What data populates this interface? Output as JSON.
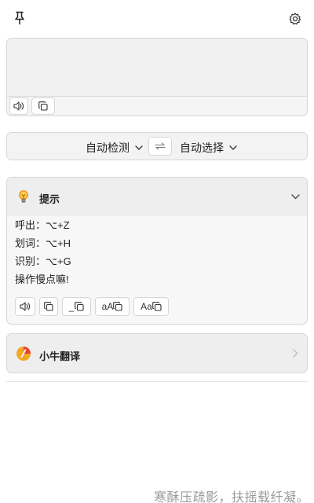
{
  "topbar": {
    "pin_icon": "pin-icon",
    "settings_icon": "gear-icon"
  },
  "input": {
    "text": "",
    "speak_icon": "speaker-icon",
    "copy_icon": "copy-icon"
  },
  "language": {
    "source": "自动检测",
    "target": "自动选择",
    "swap_icon": "swap-icon"
  },
  "result_card": {
    "title": "提示",
    "icon": "lightbulb-icon",
    "lines": [
      "呼出：⌥+Z",
      "划词：⌥+H",
      "识别：⌥+G",
      "操作慢点嘛!"
    ],
    "actions": {
      "speak_icon": "speaker-icon",
      "copy_icon": "copy-icon",
      "underscore_label": "_",
      "camel_label": "aA",
      "title_label": "Aa"
    }
  },
  "engine": {
    "name": "小牛翻译",
    "icon": "niutrans-logo-icon"
  },
  "footer": {
    "watermark": "寒酥压疏影，扶摇载纤凝。"
  },
  "colors": {
    "panel_bg": "#f3f3f3",
    "border": "#d6d6d6",
    "bulb": "#f0a020",
    "logo_orange": "#f5a623",
    "logo_red": "#e8412c"
  }
}
